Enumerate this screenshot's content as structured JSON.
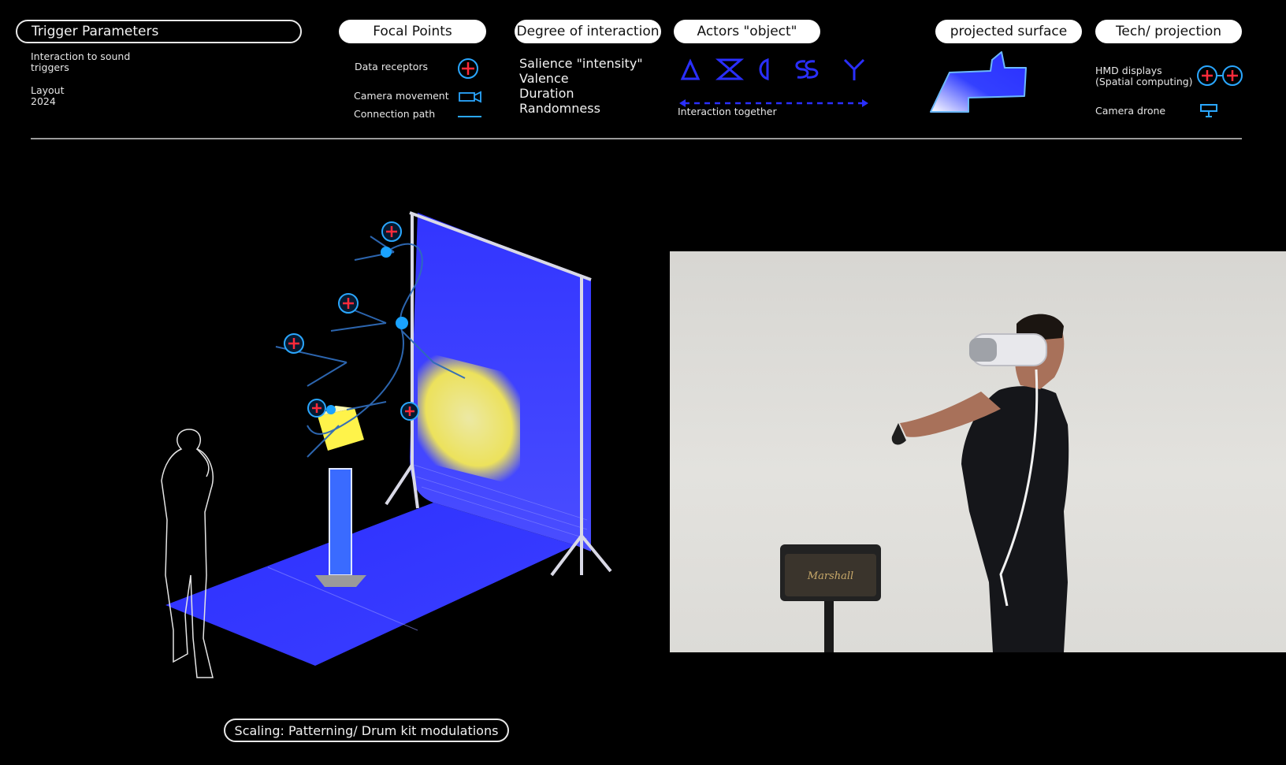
{
  "header": {
    "trigger": {
      "title": "Trigger Parameters",
      "line1": "Interaction to sound",
      "line2": "triggers",
      "line3": "Layout",
      "line4": "2024"
    },
    "focal": {
      "title": "Focal Points",
      "items": [
        "Data receptors",
        "Camera movement",
        "Connection path"
      ]
    },
    "degree": {
      "title": "Degree of interaction",
      "items": [
        "Salience \"intensity\"",
        "Valence",
        "Duration",
        "Randomness"
      ]
    },
    "actors": {
      "title": "Actors \"object\"",
      "caption": "Interaction together"
    },
    "surface": {
      "title": "projected surface"
    },
    "tech": {
      "title": "Tech/ projection",
      "hmd_line1": "HMD displays",
      "hmd_line2": "(Spatial computing)",
      "drone": "Camera drone"
    }
  },
  "caption": "Scaling: Patterning/ Drum kit modulations",
  "colors": {
    "background": "#000000",
    "accent_blue": "#2a2fff",
    "receptor_red": "#ff2a3a",
    "receptor_ring": "#2aa7ff",
    "yellow_panel": "#fff34a"
  }
}
